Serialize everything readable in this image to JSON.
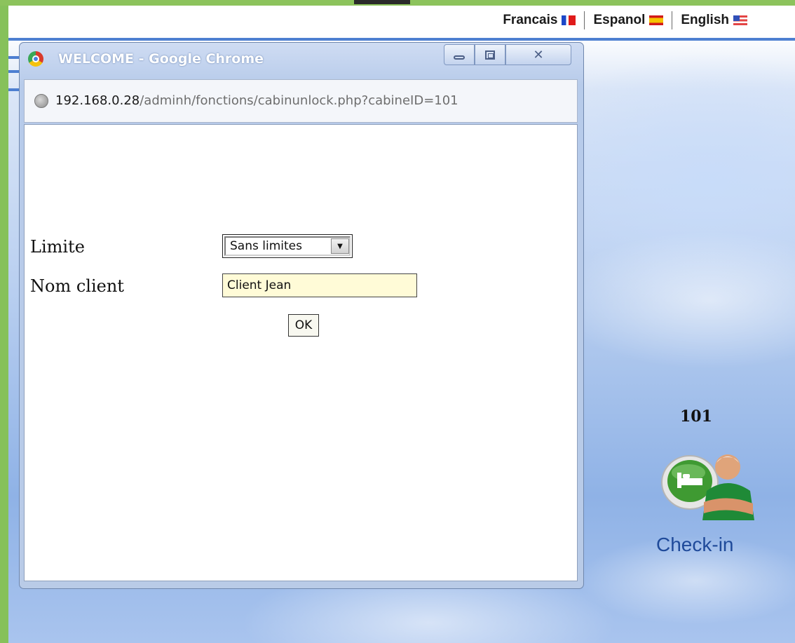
{
  "language_bar": {
    "items": [
      {
        "label": "Francais",
        "flag_icon": "france-flag-icon"
      },
      {
        "label": "Espanol",
        "flag_icon": "spain-flag-icon"
      },
      {
        "label": "English",
        "flag_icon": "usa-flag-icon"
      }
    ]
  },
  "popup": {
    "title": "WELCOME - Google Chrome",
    "url_host": "192.168.0.28",
    "url_path": "/adminh/fonctions/cabinunlock.php?cabineID=101",
    "form": {
      "limite_label": "Limite",
      "limite_value": "Sans limites",
      "nom_client_label": "Nom client",
      "nom_client_value": "Client Jean",
      "ok_label": "OK"
    }
  },
  "cabin": {
    "number": "101",
    "action_label": "Check-in"
  },
  "colors": {
    "accent_green": "#8cc35c",
    "link_blue": "#1f4a9a",
    "input_bg": "#fffbd7",
    "nav_line": "#4d7fd1"
  }
}
